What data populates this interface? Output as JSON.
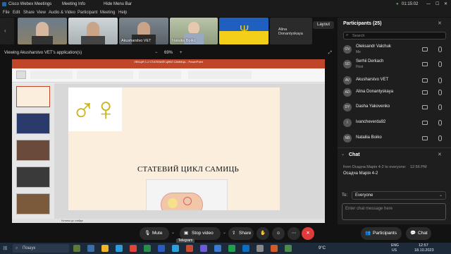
{
  "window": {
    "app_title": "Cisco Webex Meetings",
    "meeting_info": "Meeting Info",
    "hide_menu": "Hide Menu Bar",
    "timer": "01:15:02"
  },
  "menu": [
    "File",
    "Edit",
    "Share",
    "View",
    "Audio & Video",
    "Participant",
    "Meeting",
    "Help"
  ],
  "layout_label": "Layout",
  "videos": [
    {
      "name": ""
    },
    {
      "name": ""
    },
    {
      "name": "Akusharstvo VET"
    },
    {
      "name": "Nataliia Boiko"
    },
    {
      "name": ""
    },
    {
      "name": "Alina Donantyskaya"
    }
  ],
  "share": {
    "viewing": "Viewing Akusharstvo VET's application(s)",
    "zoom": "69%",
    "slide_title": "СТАТЕВИЙ ЦИКЛ САМИЦЬ",
    "ppt_title": "ЛЕКЦІЯ 1-2 СТАТЕВИЙ ЦИКЛ САМИЦЬ - PowerPoint",
    "notes_hint": "Нотатки до слайда"
  },
  "participants": {
    "header": "Participants (25)",
    "search_placeholder": "Search",
    "list": [
      {
        "initials": "OV",
        "name": "Oleksandr Valchuk",
        "role": "Me"
      },
      {
        "initials": "SD",
        "name": "Serhii Derkach",
        "role": "Host"
      },
      {
        "initials": "AV",
        "name": "Akusharstvo VET",
        "role": ""
      },
      {
        "initials": "AD",
        "name": "Alina Donantyskaya",
        "role": ""
      },
      {
        "initials": "DY",
        "name": "Dasha Yakovenko",
        "role": ""
      },
      {
        "initials": "I",
        "name": "ivancheverda92",
        "role": ""
      },
      {
        "initials": "NB",
        "name": "Nataliia Boiko",
        "role": ""
      }
    ]
  },
  "chat": {
    "header": "Chat",
    "message_meta": "from Осадча Марія 4-2 to everyone:",
    "message_time": "12:56 PM",
    "message_text": "Осадча Марія 4-2",
    "to_label": "To:",
    "to_value": "Everyone",
    "input_placeholder": "Enter chat message here"
  },
  "controls": {
    "mute": "Mute",
    "stop_video": "Stop video",
    "share": "Share",
    "participants": "Participants",
    "chat": "Chat",
    "tooltip": "Telegram"
  },
  "taskbar": {
    "search_placeholder": "Пошук",
    "weather": "9°C",
    "lang": "ENG",
    "lang2": "US",
    "time": "12:57",
    "date": "18.10.2023"
  },
  "colors": {
    "accent": "#3b82f6",
    "end_call": "#e03b3b",
    "ppt_red": "#c0462a"
  }
}
